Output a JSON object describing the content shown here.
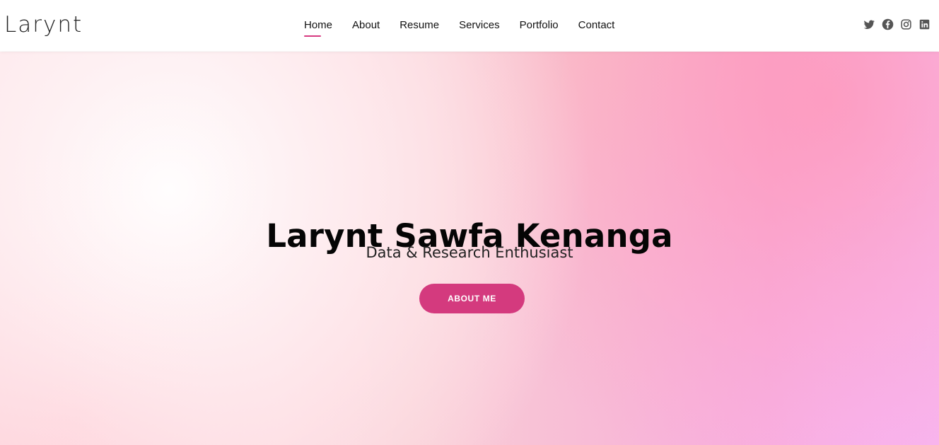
{
  "brand": {
    "logo": "Larynt"
  },
  "nav": {
    "items": [
      {
        "label": "Home"
      },
      {
        "label": "About"
      },
      {
        "label": "Resume"
      },
      {
        "label": "Services"
      },
      {
        "label": "Portfolio"
      },
      {
        "label": "Contact"
      }
    ],
    "active_index": 0
  },
  "social": {
    "icons": [
      "twitter-icon",
      "facebook-icon",
      "instagram-icon",
      "linkedin-icon"
    ]
  },
  "hero": {
    "title": "Larynt Sawfa Kenanga",
    "subtitle": "Data & Research Enthusiast",
    "button": "ABOUT ME"
  },
  "colors": {
    "accent": "#d43a7e",
    "text_dark": "#111111",
    "icon_gray": "#555555",
    "hero_pink": "#f7a8c8",
    "hero_light": "#fbe8eb",
    "hero_lavender": "#f7bde9"
  }
}
